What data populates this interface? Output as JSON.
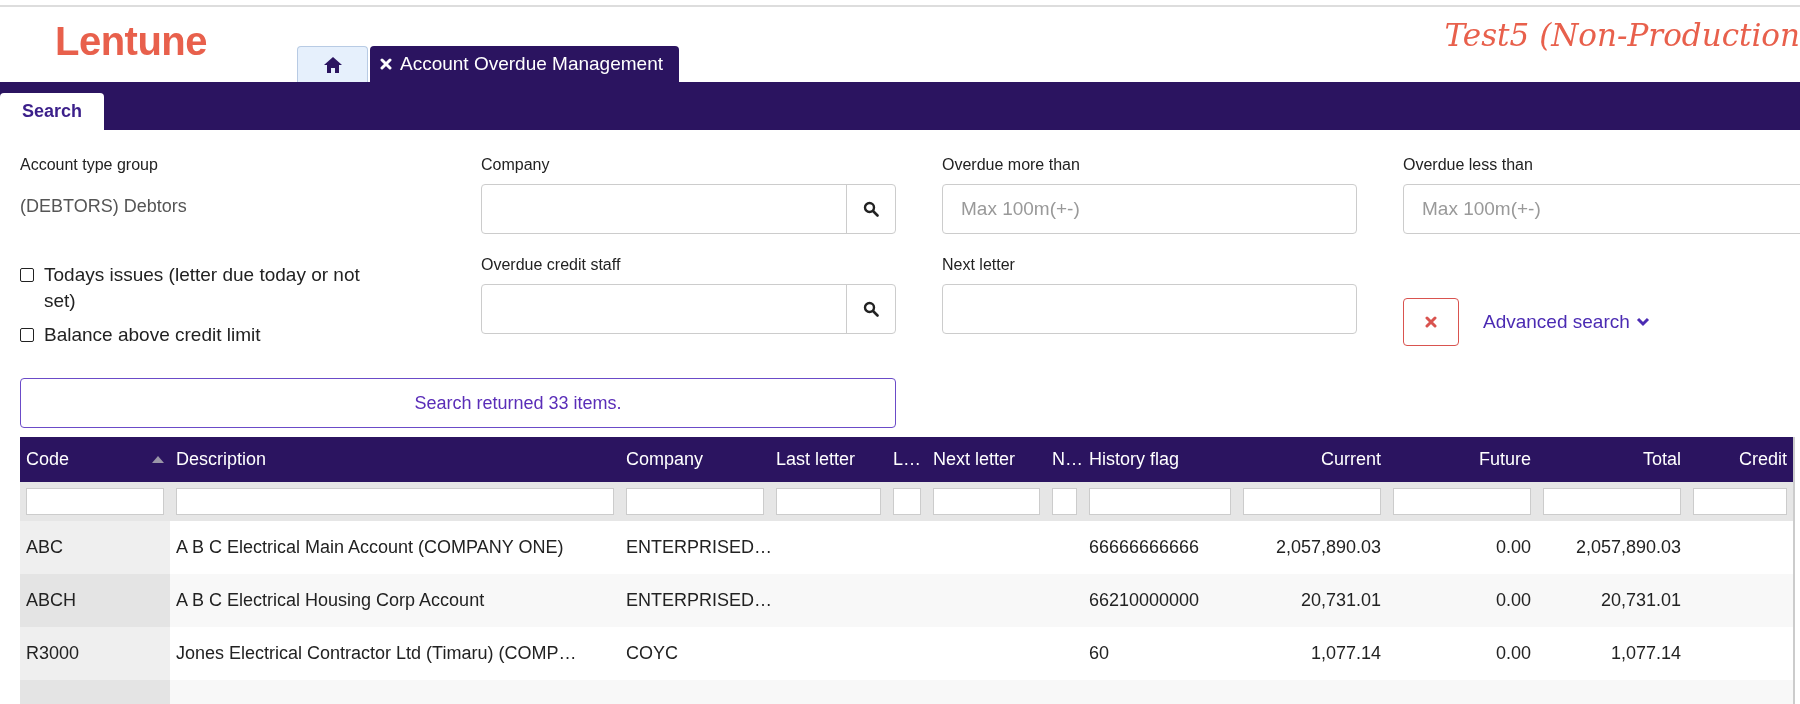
{
  "header": {
    "logo": "Lentune",
    "environment": "Test5 (Non-Production"
  },
  "tabs": [
    {
      "kind": "home",
      "selected": false
    },
    {
      "kind": "page",
      "label": "Account Overdue Management",
      "selected": true
    }
  ],
  "subtabs": [
    {
      "label": "Search",
      "selected": true
    }
  ],
  "search": {
    "account_type_group": {
      "label": "Account type group",
      "value": "(DEBTORS) Debtors"
    },
    "checkboxes": [
      {
        "label": "Todays issues (letter due today or not set)",
        "checked": false
      },
      {
        "label": "Balance above credit limit",
        "checked": false
      }
    ],
    "fields": [
      {
        "kind": "lookup",
        "label": "Company"
      },
      {
        "kind": "text",
        "label": "Overdue more than",
        "placeholder": "Max 100m(+-)"
      },
      {
        "kind": "text",
        "label": "Overdue less than",
        "placeholder": "Max 100m(+-)"
      },
      {
        "kind": "lookup",
        "label": "Overdue credit staff"
      },
      {
        "kind": "text",
        "label": "Next letter"
      }
    ],
    "advanced_search": "Advanced search",
    "result": "Search returned 33 items."
  },
  "table": {
    "columns": [
      {
        "kind": "text",
        "label": "Code",
        "sorted": true
      },
      {
        "kind": "text",
        "label": "Description",
        "sorted": false
      },
      {
        "kind": "text",
        "label": "Company",
        "sorted": false
      },
      {
        "kind": "text",
        "label": "Last letter",
        "sorted": false
      },
      {
        "kind": "text",
        "label": "L…",
        "sorted": false
      },
      {
        "kind": "text",
        "label": "Next letter",
        "sorted": false
      },
      {
        "kind": "text",
        "label": "N…",
        "sorted": false
      },
      {
        "kind": "text",
        "label": "History flag",
        "sorted": false
      },
      {
        "kind": "number",
        "label": "Current",
        "sorted": false
      },
      {
        "kind": "number",
        "label": "Future",
        "sorted": false
      },
      {
        "kind": "number",
        "label": "Total",
        "sorted": false
      },
      {
        "kind": "number",
        "label": "Credit",
        "sorted": false
      }
    ],
    "rows": [
      [
        "ABC",
        "A B C Electrical Main Account (COMPANY ONE)",
        "ENTERPRISED…",
        null,
        null,
        null,
        null,
        "66666666666",
        "2,057,890.03",
        "0.00",
        "2,057,890.03",
        null
      ],
      [
        "ABCH",
        "A B C Electrical Housing Corp Account",
        "ENTERPRISED…",
        null,
        null,
        null,
        null,
        "66210000000",
        "20,731.01",
        "0.00",
        "20,731.01",
        null
      ],
      [
        "R3000",
        "Jones Electrical Contractor Ltd (Timaru) (COMP…",
        "COYC",
        null,
        null,
        null,
        null,
        "60",
        "1,077.14",
        "0.00",
        "1,077.14",
        null
      ]
    ]
  }
}
